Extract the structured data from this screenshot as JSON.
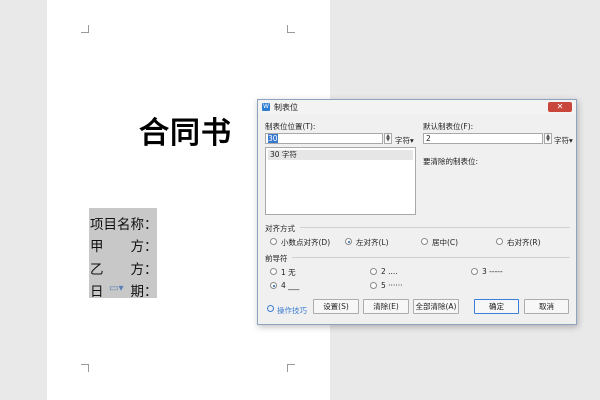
{
  "document": {
    "title": "合同书",
    "fields": [
      "项目名称：",
      "甲　　方：",
      "乙　　方：",
      "日　　期："
    ]
  },
  "dialog": {
    "title": "制表位",
    "close_label": "✕",
    "tab_position_label": "制表位位置(T):",
    "tab_position_value": "30",
    "unit_char": "字符",
    "tab_list": [
      "30 字符"
    ],
    "default_tab_label": "默认制表位(F):",
    "default_tab_value": "2",
    "to_clear_label": "要清除的制表位:",
    "alignment": {
      "label": "对齐方式",
      "options": [
        "小数点对齐(D)",
        "左对齐(L)",
        "居中(C)",
        "右对齐(R)"
      ],
      "selected": "左对齐(L)"
    },
    "leader": {
      "label": "前导符",
      "options": [
        "1 无",
        "2 ....",
        "3 -----",
        "4 ___",
        "5 ······"
      ],
      "selected": "4 ___"
    },
    "help_label": "操作技巧",
    "buttons": {
      "set": "设置(S)",
      "clear": "清除(E)",
      "clear_all": "全部清除(A)",
      "ok": "确定",
      "cancel": "取消"
    }
  },
  "colors": {
    "accent": "#3e7fd0",
    "close": "#c9463d",
    "field_highlight": "#c8c8c8"
  }
}
